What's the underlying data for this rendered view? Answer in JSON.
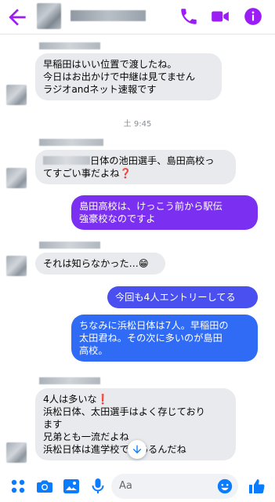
{
  "header": {
    "accent_color": "#9b1cf5",
    "icons": [
      "back-arrow-icon",
      "phone-icon",
      "video-camera-icon",
      "info-icon"
    ]
  },
  "messages": [
    {
      "side": "in",
      "lines": [
        "早稲田はいい位置で渡したね。",
        "今日はお出かけで中継は見てません",
        "ラジオandネット速報です"
      ]
    },
    {
      "side": "separator",
      "text": "土 9:45"
    },
    {
      "side": "in",
      "lines": [
        "日体の池田選手、島田高校っ",
        "てすごい事だよね❓"
      ]
    },
    {
      "side": "out",
      "lines": [
        "島田高校は、けっこう前から駅伝",
        "強豪校なのですよ"
      ]
    },
    {
      "side": "in",
      "lines": [
        "それは知らなかった…😁"
      ]
    },
    {
      "side": "out",
      "lines": [
        "今回も4人エントリーしてる"
      ]
    },
    {
      "side": "out",
      "lines": [
        "ちなみに浜松日体は7人。早稲田の",
        "太田君ね。その次に多いのが島田",
        "高校。"
      ]
    },
    {
      "side": "in",
      "lines": [
        "4人は多いな❗",
        "浜松日体、太田選手はよく存じており",
        "ます",
        "兄弟とも一流だよね",
        "浜松日体は進学校でもあるんだね"
      ]
    }
  ],
  "colors": {
    "incoming_bubble": "#e9eaed",
    "outgoing_purple": "#7b2ff0",
    "outgoing_blue": "#2f6bf5",
    "composer_icons": "#0a7cff"
  },
  "composer": {
    "placeholder": "Aa",
    "icons": [
      "apps-icon",
      "camera-icon",
      "image-icon",
      "microphone-icon",
      "emoji-icon",
      "like-icon"
    ]
  }
}
